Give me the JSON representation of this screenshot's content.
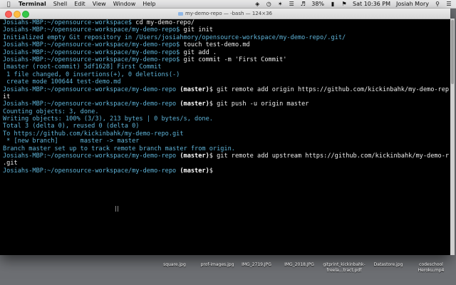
{
  "menubar": {
    "app": "Terminal",
    "items": [
      "Shell",
      "Edit",
      "View",
      "Window",
      "Help"
    ],
    "battery": "38%",
    "clock": "Sat 10:36 PM",
    "user": "Josiah Mory"
  },
  "window": {
    "title": "my-demo-repo — -bash — 124×36"
  },
  "terminal_lines": [
    [
      {
        "t": "Josiahs-MBP:~/opensource-workspace$ ",
        "c": "prompt"
      },
      {
        "t": "cd my-demo-repo/",
        "c": "cmd"
      }
    ],
    [
      {
        "t": "Josiahs-MBP:~/opensource-workspace/my-demo-repo$ ",
        "c": "prompt"
      },
      {
        "t": "git init",
        "c": "cmd"
      }
    ],
    [
      {
        "t": "Initialized empty Git repository in /Users/josiahmory/opensource-workspace/my-demo-repo/.git/",
        "c": "out"
      }
    ],
    [
      {
        "t": "Josiahs-MBP:~/opensource-workspace/my-demo-repo$ ",
        "c": "prompt"
      },
      {
        "t": "touch test-demo.md",
        "c": "cmd"
      }
    ],
    [
      {
        "t": "Josiahs-MBP:~/opensource-workspace/my-demo-repo$ ",
        "c": "prompt"
      },
      {
        "t": "git add .",
        "c": "cmd"
      }
    ],
    [
      {
        "t": "Josiahs-MBP:~/opensource-workspace/my-demo-repo$ ",
        "c": "prompt"
      },
      {
        "t": "git commit -m 'First Commit'",
        "c": "cmd"
      }
    ],
    [
      {
        "t": "[master (root-commit) 5df1628] First Commit",
        "c": "out"
      }
    ],
    [
      {
        "t": " 1 file changed, 0 insertions(+), 0 deletions(-)",
        "c": "out"
      }
    ],
    [
      {
        "t": " create mode 100644 test-demo.md",
        "c": "out"
      }
    ],
    [
      {
        "t": "Josiahs-MBP:~/opensource-workspace/my-demo-repo ",
        "c": "prompt"
      },
      {
        "t": "(master)",
        "c": "branch"
      },
      {
        "t": "$ git remote add origin https://github.com/kickinbahk/my-demo-repo.g",
        "c": "cmd"
      }
    ],
    [
      {
        "t": "it",
        "c": "cmd"
      }
    ],
    [
      {
        "t": "Josiahs-MBP:~/opensource-workspace/my-demo-repo ",
        "c": "prompt"
      },
      {
        "t": "(master)",
        "c": "branch"
      },
      {
        "t": "$ git push -u origin master",
        "c": "cmd"
      }
    ],
    [
      {
        "t": "Counting objects: 3, done.",
        "c": "out"
      }
    ],
    [
      {
        "t": "Writing objects: 100% (3/3), 213 bytes | 0 bytes/s, done.",
        "c": "out"
      }
    ],
    [
      {
        "t": "Total 3 (delta 0), reused 0 (delta 0)",
        "c": "out"
      }
    ],
    [
      {
        "t": "To https://github.com/kickinbahk/my-demo-repo.git",
        "c": "out"
      }
    ],
    [
      {
        "t": " * [new branch]      master -> master",
        "c": "out"
      }
    ],
    [
      {
        "t": "Branch master set up to track remote branch master from origin.",
        "c": "out"
      }
    ],
    [
      {
        "t": "Josiahs-MBP:~/opensource-workspace/my-demo-repo ",
        "c": "prompt"
      },
      {
        "t": "(master)",
        "c": "branch"
      },
      {
        "t": "$ git remote add upstream https://github.com/kickinbahk/my-demo-repo",
        "c": "cmd"
      }
    ],
    [
      {
        "t": ".git",
        "c": "cmd"
      }
    ],
    [
      {
        "t": "Josiahs-MBP:~/opensource-workspace/my-demo-repo ",
        "c": "prompt"
      },
      {
        "t": "(master)",
        "c": "branch"
      },
      {
        "t": "$ ",
        "c": "cmd"
      }
    ]
  ],
  "desktop_files": [
    "square.jpg",
    "prof-images.jpg",
    "IMG_2719.JPG",
    "IMG_2018.JPG",
    "gitprint_kickinbahk-freela...tract.pdf",
    "Datastore.jpg",
    "codeschool Heroku.mp4"
  ]
}
